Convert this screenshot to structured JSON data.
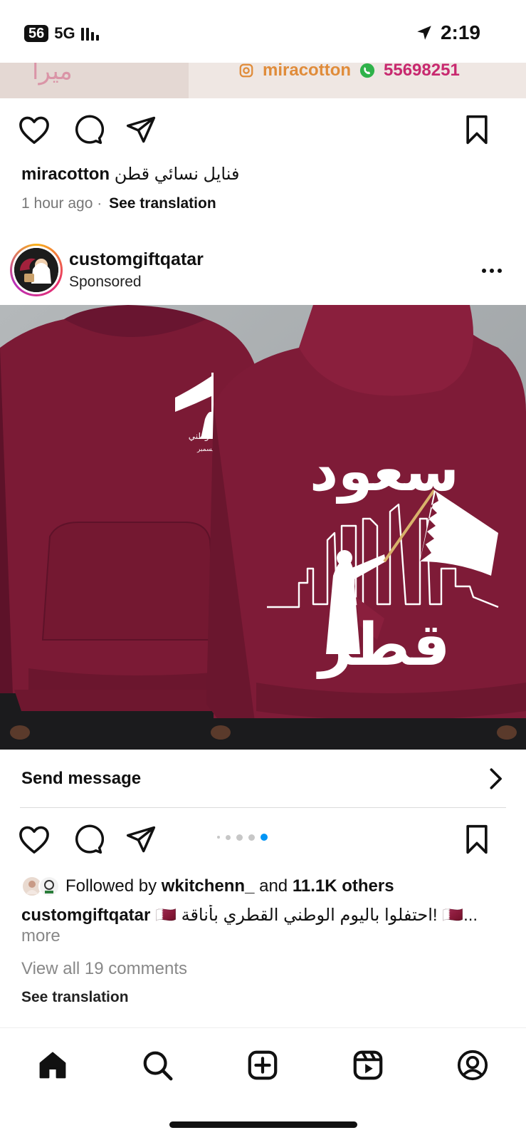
{
  "status_bar": {
    "battery": "56",
    "network": "5G",
    "time": "2:19"
  },
  "prev_post": {
    "banner_brand": "ميرا",
    "banner_handle": "miracotton",
    "banner_phone": "55698251",
    "caption_user": "miracotton",
    "caption_text": "فنايل نسائي قطن",
    "time_ago": "1 hour ago",
    "see_translation": "See translation"
  },
  "post": {
    "username": "customgiftqatar",
    "sponsored_label": "Sponsored",
    "media_text_top": "سعود",
    "media_text_bottom": "قطر",
    "media_logo_text": "اليوم الوطني",
    "media_logo_date": "١٨ ديسمبر",
    "send_message_label": "Send message",
    "carousel_count": 5,
    "carousel_active_index": 4,
    "followed_prefix": "Followed by",
    "followed_user": "wkitchenn_",
    "followed_and": "and",
    "followed_others": "11.1K others",
    "caption_user": "customgiftqatar",
    "caption_text": "🇶🇦 احتفلوا باليوم الوطني القطري بأناقة! 🇶🇦...",
    "more_label": "more",
    "view_comments": "View all 19 comments",
    "see_translation": "See translation"
  },
  "icons": {
    "like": "heart-icon",
    "comment": "comment-icon",
    "share": "send-icon",
    "save": "bookmark-icon",
    "chevron": "chevron-right-icon",
    "location": "location-arrow-icon"
  },
  "nav": {
    "items": [
      "home-icon",
      "search-icon",
      "create-icon",
      "reels-icon",
      "profile-icon"
    ]
  },
  "colors": {
    "hoodie": "#7b1a35",
    "carousel_active": "#0095f6",
    "muted_text": "#888888"
  }
}
